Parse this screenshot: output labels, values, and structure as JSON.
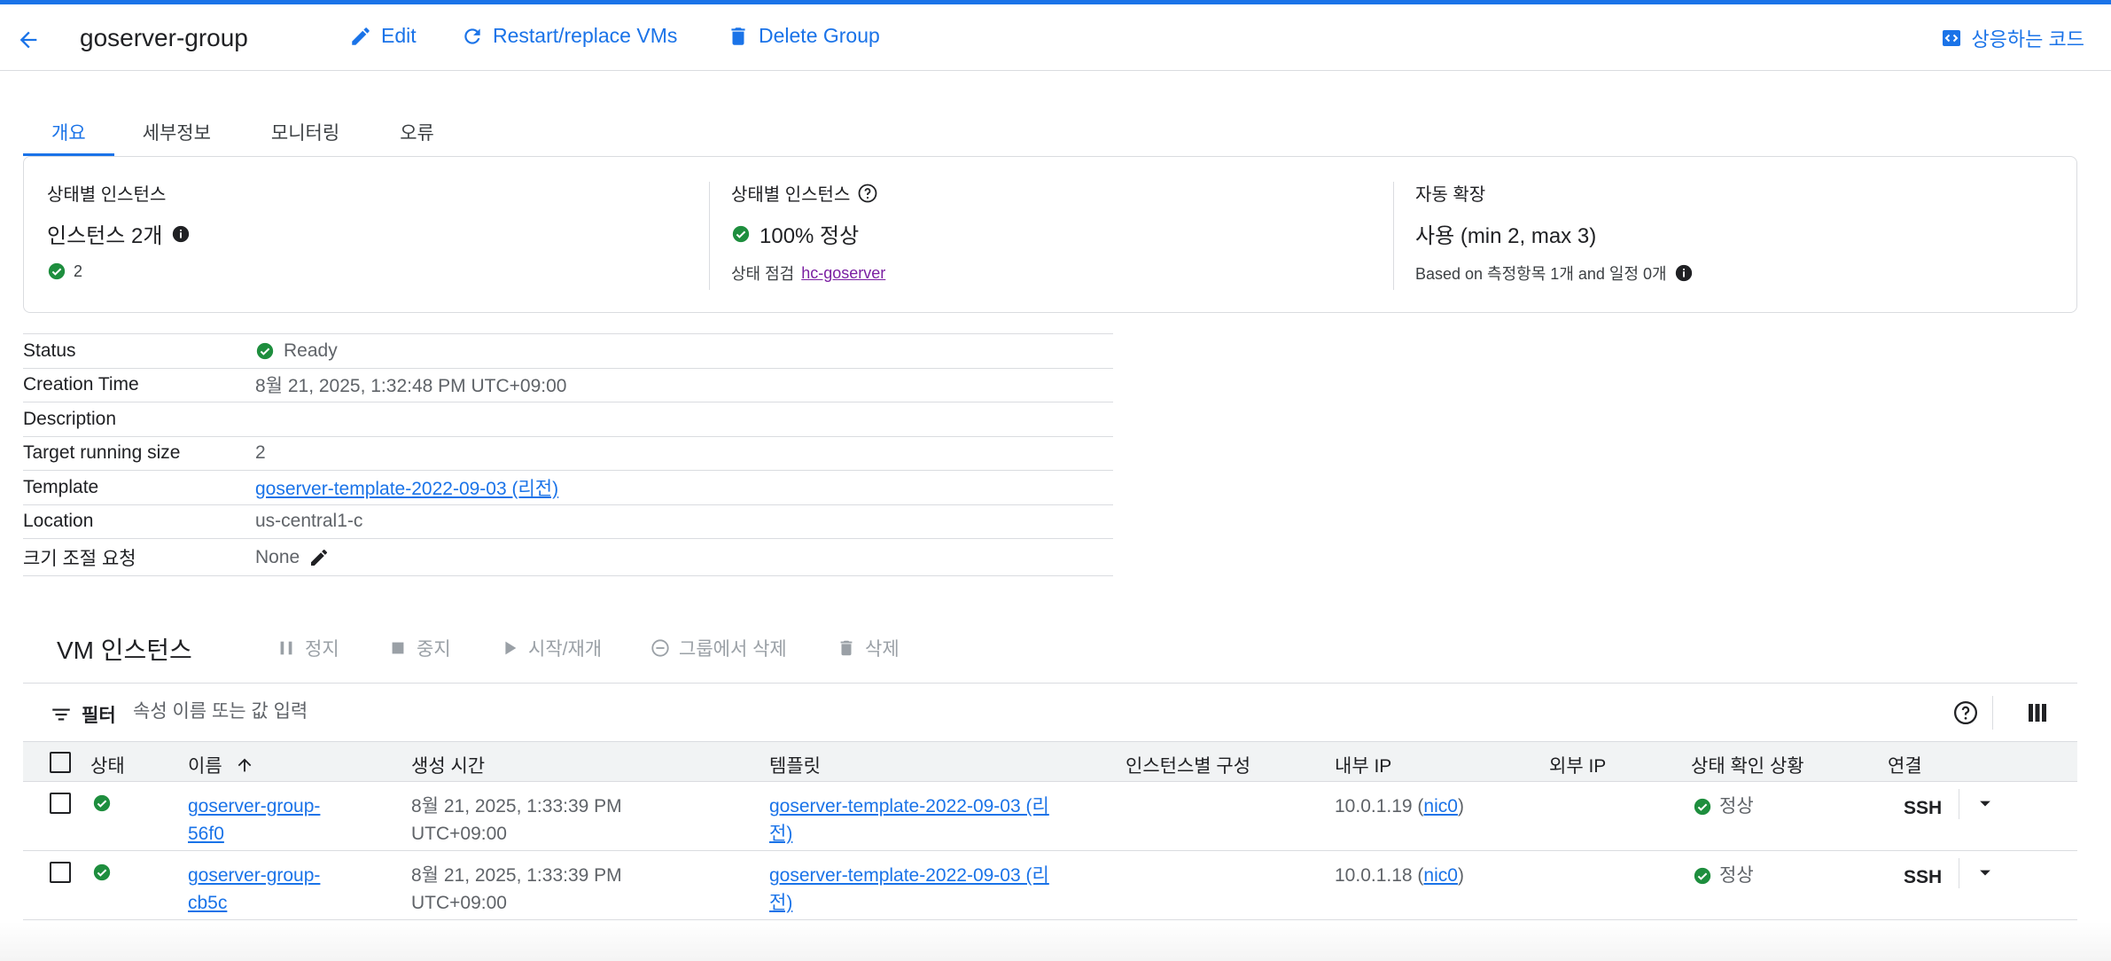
{
  "header": {
    "title": "goserver-group",
    "edit_label": "Edit",
    "restart_label": "Restart/replace VMs",
    "delete_label": "Delete Group",
    "equivalent_code_label": "상응하는 코드"
  },
  "tabs": [
    {
      "label": "개요",
      "active": true
    },
    {
      "label": "세부정보",
      "active": false
    },
    {
      "label": "모니터링",
      "active": false
    },
    {
      "label": "오류",
      "active": false
    }
  ],
  "summary": {
    "instances": {
      "label": "상태별 인스턴스",
      "value": "인스턴스 2개",
      "count": "2"
    },
    "health": {
      "label": "상태별 인스턴스",
      "value": "100% 정상",
      "check_label": "상태 점검",
      "check_link": "hc-goserver"
    },
    "autoscaling": {
      "label": "자동 확장",
      "value": "사용 (min 2, max 3)",
      "note": "Based on 측정항목 1개 and 일정 0개"
    }
  },
  "details": [
    {
      "key": "Status",
      "value": "Ready"
    },
    {
      "key": "Creation Time",
      "value": "8월 21, 2025, 1:32:48 PM UTC+09:00"
    },
    {
      "key": "Description",
      "value": ""
    },
    {
      "key": "Target running size",
      "value": "2"
    },
    {
      "key": "Template",
      "value": "goserver-template-2022-09-03 (리전)"
    },
    {
      "key": "Location",
      "value": "us-central1-c"
    },
    {
      "key": "크기 조절 요청",
      "value": "None"
    }
  ],
  "vm_section": {
    "title": "VM 인스턴스",
    "actions": {
      "pause": "정지",
      "stop": "중지",
      "start": "시작/재개",
      "remove": "그룹에서 삭제",
      "delete": "삭제"
    },
    "filter_label": "필터",
    "filter_placeholder": "속성 이름 또는 값 입력"
  },
  "vm_table": {
    "columns": {
      "status": "상태",
      "name": "이름",
      "created": "생성 시간",
      "template": "템플릿",
      "per_instance": "인스턴스별 구성",
      "internal_ip": "내부 IP",
      "external_ip": "외부 IP",
      "health": "상태 확인 상황",
      "connect": "연결"
    },
    "rows": [
      {
        "name_l1": "goserver-group-",
        "name_l2": "56f0",
        "created_l1": "8월 21, 2025, 1:33:39 PM",
        "created_l2": "UTC+09:00",
        "template_l1": "goserver-template-2022-09-03 (리",
        "template_l2": "전)",
        "ip": "10.0.1.19",
        "nic": "nic0",
        "health": "정상",
        "connect": "SSH"
      },
      {
        "name_l1": "goserver-group-",
        "name_l2": "cb5c",
        "created_l1": "8월 21, 2025, 1:33:39 PM",
        "created_l2": "UTC+09:00",
        "template_l1": "goserver-template-2022-09-03 (리",
        "template_l2": "전)",
        "ip": "10.0.1.18",
        "nic": "nic0",
        "health": "정상",
        "connect": "SSH"
      }
    ]
  },
  "colors": {
    "accent": "#1a73e8",
    "success": "#1e8e3e",
    "visited_link": "#7b1fa2",
    "disabled": "#9aa0a6"
  }
}
